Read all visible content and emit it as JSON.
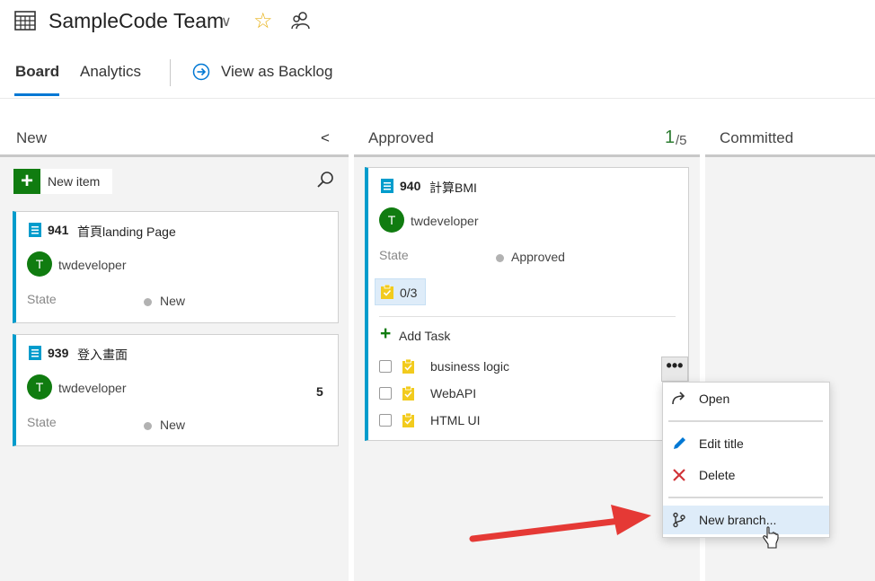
{
  "header": {
    "team_name": "SampleCode Team",
    "chevron": "∨",
    "star": "☆",
    "team_icon": "board-icon",
    "people_icon": "team-members-icon"
  },
  "tabs": {
    "board": "Board",
    "analytics": "Analytics",
    "view_backlog": "View as Backlog",
    "view_backlog_icon": "arrow-circle-right-icon"
  },
  "columns": [
    {
      "title": "New"
    },
    {
      "title": "Approved",
      "wip_count": "1",
      "wip_limit": "/5"
    },
    {
      "title": "Committed"
    }
  ],
  "new_column": {
    "collapse_chevron": "<",
    "new_item_label": "New item",
    "search_icon": "search-icon"
  },
  "cards": [
    {
      "id": "941",
      "title": "首頁landing Page",
      "avatar": "T",
      "assignee": "twdeveloper",
      "state_label": "State",
      "state": "New",
      "effort": ""
    },
    {
      "id": "939",
      "title": "登入畫面",
      "avatar": "T",
      "assignee": "twdeveloper",
      "state_label": "State",
      "state": "New",
      "effort": "5"
    },
    {
      "id": "940",
      "title": "計算BMI",
      "avatar": "T",
      "assignee": "twdeveloper",
      "state_label": "State",
      "state": "Approved",
      "task_progress": "0/3"
    }
  ],
  "tasks": {
    "add_task_label": "Add Task",
    "items": [
      {
        "title": "business logic"
      },
      {
        "title": "WebAPI"
      },
      {
        "title": "HTML UI"
      }
    ]
  },
  "more_button": "•••",
  "context_menu": {
    "items": [
      {
        "label": "Open",
        "icon": "open-arrow-icon"
      },
      {
        "label": "Edit title",
        "icon": "pencil-icon"
      },
      {
        "label": "Delete",
        "icon": "delete-x-icon"
      },
      {
        "label": "New branch...",
        "icon": "branch-icon"
      }
    ]
  },
  "colors": {
    "accent": "#0078d4",
    "card_border": "#009ccc",
    "avatar": "#107c10",
    "task_yellow": "#f2cb1d",
    "annotation_arrow": "#e53935"
  }
}
